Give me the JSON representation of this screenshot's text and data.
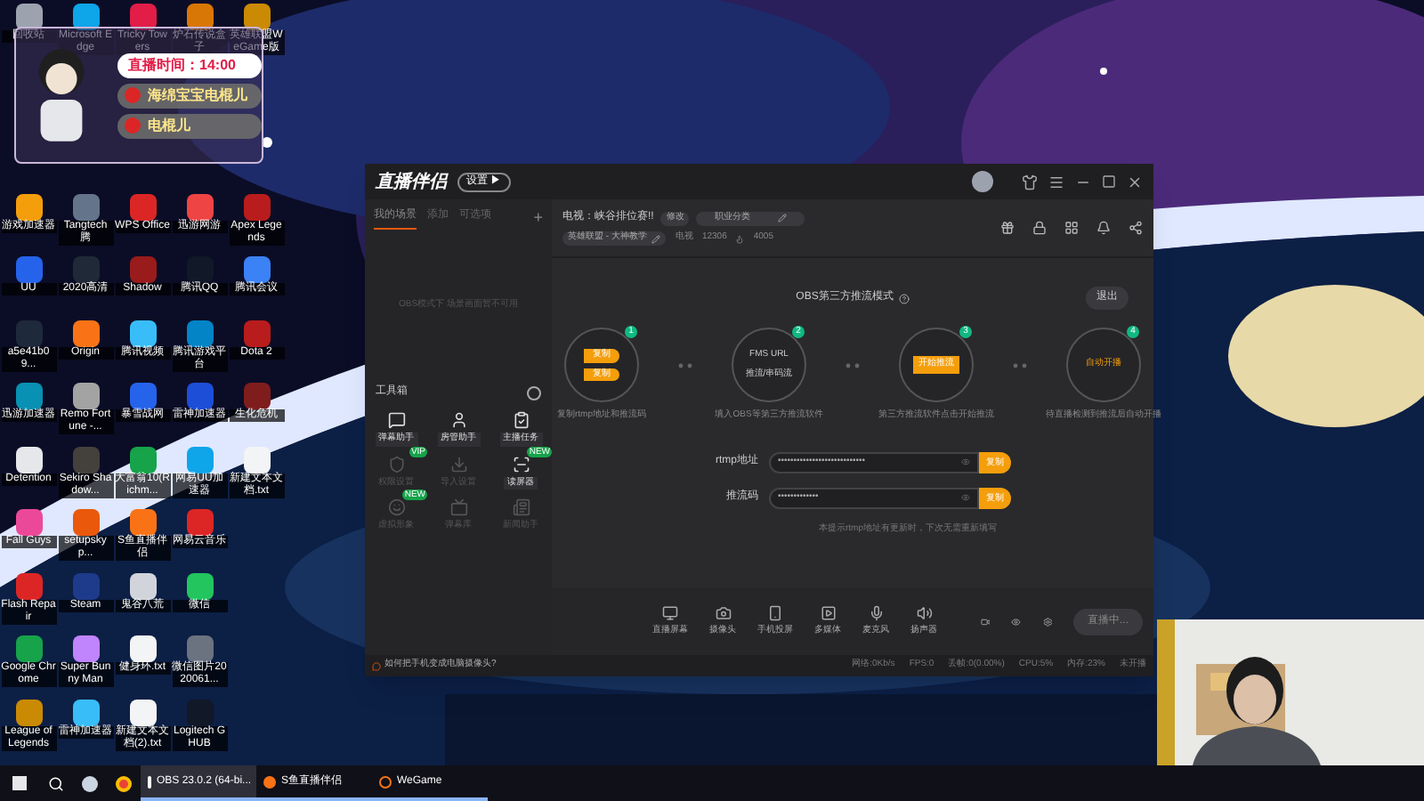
{
  "desktop_rows": [
    [
      {
        "kind": "app",
        "label": "回收站",
        "color": "#9ca3af"
      },
      {
        "kind": "app",
        "label": "Microsoft Edge",
        "color": "#0ea5e9"
      },
      {
        "kind": "app",
        "label": "Tricky Towers",
        "color": "#e11d48"
      },
      {
        "kind": "app",
        "label": "炉石传说盒子",
        "color": "#d97706"
      },
      {
        "kind": "app",
        "label": "英雄联盟WeGame版",
        "color": "#ca8a04"
      }
    ],
    [
      {
        "kind": "empty"
      },
      {
        "kind": "empty"
      },
      {
        "kind": "empty"
      },
      {
        "kind": "empty"
      },
      {
        "kind": "empty"
      }
    ],
    [
      {
        "kind": "empty"
      },
      {
        "kind": "empty"
      },
      {
        "kind": "empty"
      },
      {
        "kind": "empty"
      },
      {
        "kind": "empty"
      }
    ],
    [
      {
        "kind": "app",
        "label": "游戏加速器",
        "color": "#f59e0b"
      },
      {
        "kind": "app",
        "label": "Tangtech 腾",
        "color": "#64748b"
      },
      {
        "kind": "app",
        "label": "WPS Office",
        "color": "#dc2626"
      },
      {
        "kind": "app",
        "label": "迅游网游",
        "color": "#ef4444"
      },
      {
        "kind": "app",
        "label": "Apex Legends",
        "color": "#b91c1c"
      }
    ],
    [
      {
        "kind": "app",
        "label": "UU",
        "color": "#2563eb"
      },
      {
        "kind": "app",
        "label": "2020高清",
        "color": "#1f2937"
      },
      {
        "kind": "app",
        "label": "Shadow",
        "color": "#991b1b"
      },
      {
        "kind": "app",
        "label": "腾讯QQ",
        "color": "#111827"
      },
      {
        "kind": "app",
        "label": "腾讯会议",
        "color": "#3b82f6"
      }
    ],
    [
      {
        "kind": "app",
        "label": "a5e41b09...",
        "color": "#1e293b"
      },
      {
        "kind": "app",
        "label": "Origin",
        "color": "#f97316"
      },
      {
        "kind": "app",
        "label": "腾讯视频",
        "color": "#38bdf8"
      },
      {
        "kind": "app",
        "label": "腾讯游戏平台",
        "color": "#0284c7"
      },
      {
        "kind": "app",
        "label": "Dota 2",
        "color": "#b91c1c"
      }
    ],
    [
      {
        "kind": "app",
        "label": "迅游加速器",
        "color": "#0891b2"
      },
      {
        "kind": "app",
        "label": "Remo Fortune -...",
        "color": "#a3a3a3"
      },
      {
        "kind": "app",
        "label": "暴雪战网",
        "color": "#2563eb"
      },
      {
        "kind": "app",
        "label": "雷神加速器",
        "color": "#1d4ed8"
      },
      {
        "kind": "app",
        "label": "生化危机",
        "color": "#7f1d1d"
      }
    ],
    [
      {
        "kind": "app",
        "label": "Detention",
        "color": "#e5e7eb"
      },
      {
        "kind": "app",
        "label": "Sekiro Shadow...",
        "color": "#44403c"
      },
      {
        "kind": "app",
        "label": "大富翁10(Richm...",
        "color": "#16a34a"
      },
      {
        "kind": "app",
        "label": "网易UU加速器",
        "color": "#0ea5e9"
      },
      {
        "kind": "app",
        "label": "新建文本文档.txt",
        "color": "#f3f4f6"
      }
    ],
    [
      {
        "kind": "app",
        "label": "Fall Guys",
        "color": "#ec4899"
      },
      {
        "kind": "app",
        "label": "setupskyp...",
        "color": "#ea580c"
      },
      {
        "kind": "app",
        "label": "S鱼直播伴侣",
        "color": "#f97316"
      },
      {
        "kind": "app",
        "label": "网易云音乐",
        "color": "#dc2626"
      },
      {
        "kind": "empty"
      }
    ],
    [
      {
        "kind": "app",
        "label": "Flash Repair",
        "color": "#dc2626"
      },
      {
        "kind": "app",
        "label": "Steam",
        "color": "#1e3a8a"
      },
      {
        "kind": "app",
        "label": "鬼谷八荒",
        "color": "#d1d5db"
      },
      {
        "kind": "app",
        "label": "微信",
        "color": "#22c55e"
      },
      {
        "kind": "empty"
      }
    ],
    [
      {
        "kind": "app",
        "label": "Google Chrome",
        "color": "#16a34a"
      },
      {
        "kind": "app",
        "label": "Super Bunny Man",
        "color": "#c084fc"
      },
      {
        "kind": "app",
        "label": "健身环.txt",
        "color": "#f3f4f6"
      },
      {
        "kind": "app",
        "label": "微信图片2020061...",
        "color": "#6b7280"
      },
      {
        "kind": "empty"
      }
    ],
    [
      {
        "kind": "app",
        "label": "League of Legends",
        "color": "#ca8a04"
      },
      {
        "kind": "app",
        "label": "雷神加速器",
        "color": "#38bdf8"
      },
      {
        "kind": "app",
        "label": "新建文本文档(2).txt",
        "color": "#f3f4f6"
      },
      {
        "kind": "app",
        "label": "Logitech G HUB",
        "color": "#111827"
      },
      {
        "kind": "empty"
      }
    ]
  ],
  "overlay": {
    "live_time": "直播时间：14:00",
    "lines": [
      "海绵宝宝电棍儿",
      "电棍儿"
    ]
  },
  "app": {
    "logo": "直播伴侣",
    "logo_badge": "设置 ▶",
    "sidebar": {
      "tabs": [
        {
          "label": "我的场景",
          "selected": true
        },
        {
          "label": "添加",
          "selected": false
        },
        {
          "label": "可选项",
          "selected": false
        }
      ],
      "add": "+",
      "notice": "OBS模式下 场景画面暂不可用",
      "toolbox_title": "工具箱",
      "tools": [
        {
          "label": "弹幕助手",
          "disabled": false
        },
        {
          "label": "房管助手",
          "disabled": false
        },
        {
          "label": "主播任务",
          "disabled": false
        },
        {
          "label": "权限设置",
          "disabled": true,
          "badge": "VIP"
        },
        {
          "label": "导入设置",
          "disabled": true
        },
        {
          "label": "读屏器",
          "disabled": false,
          "badge": "NEW"
        },
        {
          "label": "虚拟形象",
          "disabled": true,
          "badge": "NEW"
        },
        {
          "label": "弹幕库",
          "disabled": true
        },
        {
          "label": "新闻助手",
          "disabled": true
        }
      ]
    },
    "info": {
      "title": "电视：峡谷排位赛!!",
      "edit": "修改",
      "category": "职业分类",
      "game": "英雄联盟 - 大神教学",
      "room_label": "电视",
      "room": "12306",
      "heat": "4005"
    },
    "mode_title": "OBS第三方推流模式",
    "exit": "退出",
    "steps": [
      {
        "number": "1",
        "kind": "buttons",
        "items": [
          "复制",
          "复制"
        ],
        "caption": "复制rtmp地址和推流码"
      },
      {
        "number": "2",
        "kind": "text",
        "items": [
          "FMS URL",
          "推流/串码流"
        ],
        "caption": "填入OBS等第三方推流软件"
      },
      {
        "number": "3",
        "kind": "button",
        "items": [
          "开始推流"
        ],
        "caption": "第三方推流软件点击开始推流"
      },
      {
        "number": "4",
        "kind": "label",
        "items": [
          "自动开播"
        ],
        "caption": "待直播检测到推流后自动开播"
      }
    ],
    "fields": [
      {
        "label": "rtmp地址",
        "value": "••••••••••••••••••••••••••••",
        "copy": "复制"
      },
      {
        "label": "推流码",
        "value": "•••••••••••••",
        "copy": "复制"
      }
    ],
    "hint": "本提示rtmp地址有更新时，下次无需重新填写",
    "toolbar": [
      {
        "label": "直播屏幕",
        "kind": "screen"
      },
      {
        "label": "摄像头",
        "kind": "camera"
      },
      {
        "label": "手机投屏",
        "kind": "phone"
      },
      {
        "label": "多媒体",
        "kind": "media"
      },
      {
        "label": "麦克风",
        "kind": "mic"
      },
      {
        "label": "扬声器",
        "kind": "speaker"
      }
    ],
    "live_button": "直播中...",
    "status": {
      "tip": "如何把手机变成电脑摄像头?",
      "items": [
        "网络:0Kb/s",
        "FPS:0",
        "丢帧:0(0.00%)",
        "CPU:5%",
        "内存:23%",
        "未开播"
      ]
    }
  },
  "taskbar": [
    {
      "label": "OBS 23.0.2 (64-bi...",
      "kind": "obs"
    },
    {
      "label": "S鱼直播伴侣",
      "kind": "app"
    },
    {
      "label": "WeGame",
      "kind": "wegame"
    }
  ]
}
